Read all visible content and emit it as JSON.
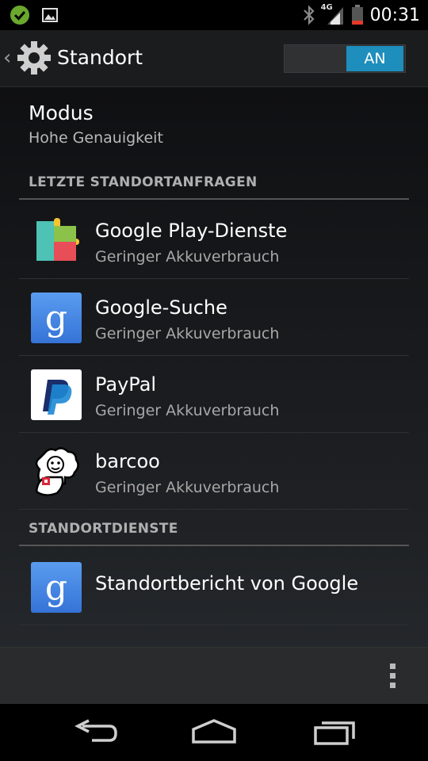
{
  "status_bar": {
    "time": "00:31",
    "network": "4G",
    "icons": [
      "check-notification-icon",
      "image-notification-icon",
      "bluetooth-icon",
      "signal-icon",
      "battery-icon"
    ]
  },
  "action_bar": {
    "title": "Standort",
    "switch_label": "AN",
    "switch_on": true,
    "accent_color": "#1e8ebd"
  },
  "mode": {
    "title": "Modus",
    "value": "Hohe Genauigkeit"
  },
  "recent_requests": {
    "header": "LETZTE STANDORTANFRAGEN",
    "items": [
      {
        "title": "Google Play-Dienste",
        "subtitle": "Geringer Akkuverbrauch",
        "icon": "google-play-services-icon"
      },
      {
        "title": "Google-Suche",
        "subtitle": "Geringer Akkuverbrauch",
        "icon": "google-search-icon"
      },
      {
        "title": "PayPal",
        "subtitle": "Geringer Akkuverbrauch",
        "icon": "paypal-icon"
      },
      {
        "title": "barcoo",
        "subtitle": "Geringer Akkuverbrauch",
        "icon": "barcoo-icon"
      }
    ]
  },
  "location_services": {
    "header": "STANDORTDIENSTE",
    "items": [
      {
        "title": "Standortbericht von Google",
        "icon": "google-search-icon"
      }
    ]
  }
}
